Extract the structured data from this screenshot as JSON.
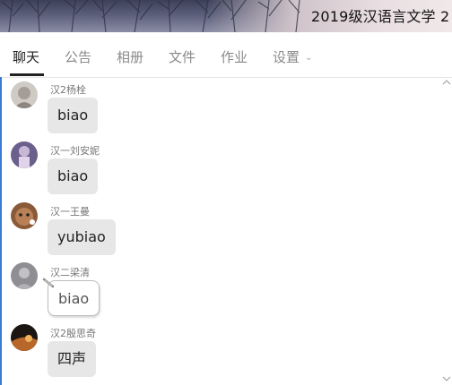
{
  "banner": {
    "title": "2019级汉语言文学 2"
  },
  "tabs": [
    {
      "label": "聊天",
      "active": true
    },
    {
      "label": "公告",
      "active": false
    },
    {
      "label": "相册",
      "active": false
    },
    {
      "label": "文件",
      "active": false
    },
    {
      "label": "作业",
      "active": false
    },
    {
      "label": "设置",
      "active": false,
      "has_dropdown": true
    }
  ],
  "messages": [
    {
      "sender": "汉2杨栓",
      "text": "biao",
      "avatar": "gray-sketch"
    },
    {
      "sender": "汉一刘安妮",
      "text": "biao",
      "avatar": "purple-figure"
    },
    {
      "sender": "汉一王曼",
      "text": "yubiao",
      "avatar": "brown-bear"
    },
    {
      "sender": "汉二梁清",
      "text": "biao",
      "avatar": "gray-photo",
      "style": "outlined"
    },
    {
      "sender": "汉2殷思奇",
      "text": "四声",
      "avatar": "sunset"
    }
  ],
  "colors": {
    "accent": "#3a7bd5",
    "bubble": "#e7e7e7",
    "active_tab": "#222222"
  }
}
